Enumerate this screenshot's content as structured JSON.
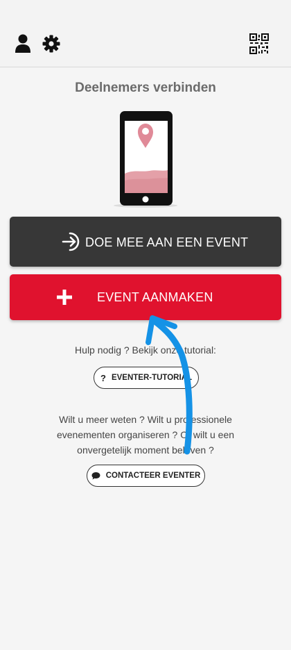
{
  "header": {
    "profile_icon": "person-icon",
    "settings_icon": "gear-icon",
    "qr_icon": "qr-code-icon"
  },
  "main": {
    "title": "Deelnemers verbinden",
    "join_button": {
      "label": "DOE MEE AAN EEN EVENT",
      "icon": "enter-icon"
    },
    "create_button": {
      "label": "EVENT AANMAKEN",
      "icon": "plus-icon"
    },
    "help_text": "Hulp nodig ? Bekijk onze tutorial:",
    "tutorial_button": {
      "label": "EVENTER-TUTORIAL",
      "icon": "question-icon"
    },
    "info_text": "Wilt u meer weten ? Wilt u professionele evenementen organiseren ? Of wilt u een onvergetelijk moment beleven ?",
    "contact_button": {
      "label": "CONTACTEER EVENTER",
      "icon": "chat-bubble-icon"
    }
  },
  "colors": {
    "join_bg": "#373737",
    "create_bg": "#e0122e",
    "annotation_arrow": "#1592e6",
    "title": "#6b6b6b"
  }
}
